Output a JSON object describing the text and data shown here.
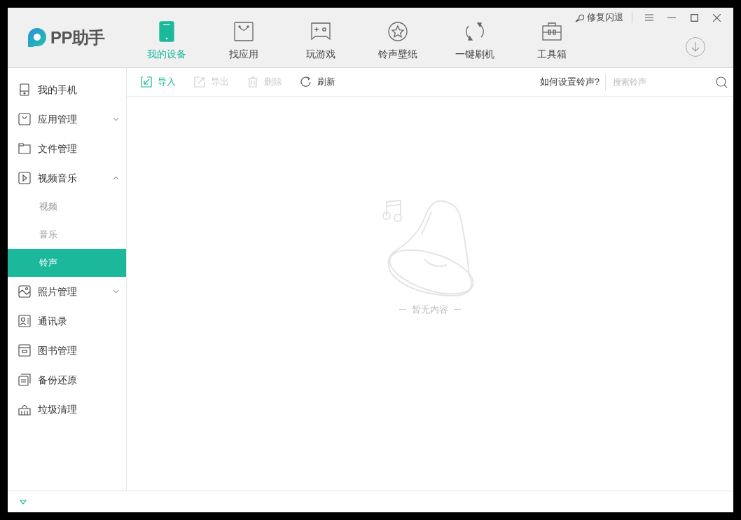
{
  "app": {
    "logo_text": "PP助手"
  },
  "nav_tabs": [
    {
      "label": "我的设备",
      "selected": true
    },
    {
      "label": "找应用",
      "selected": false
    },
    {
      "label": "玩游戏",
      "selected": false
    },
    {
      "label": "铃声壁纸",
      "selected": false
    },
    {
      "label": "一键刷机",
      "selected": false
    },
    {
      "label": "工具箱",
      "selected": false
    }
  ],
  "title_bar": {
    "repair_label": "修复闪退"
  },
  "sidebar": {
    "items": [
      {
        "label": "我的手机",
        "selected": false
      },
      {
        "label": "应用管理",
        "selected": false,
        "expanded": false
      },
      {
        "label": "文件管理",
        "selected": false
      },
      {
        "label": "视频音乐",
        "selected": false,
        "expanded": true,
        "children": [
          {
            "label": "视频",
            "selected": false
          },
          {
            "label": "音乐",
            "selected": false
          },
          {
            "label": "铃声",
            "selected": true
          }
        ]
      },
      {
        "label": "照片管理",
        "selected": false,
        "expanded": false
      },
      {
        "label": "通讯录",
        "selected": false
      },
      {
        "label": "图书管理",
        "selected": false
      },
      {
        "label": "备份还原",
        "selected": false
      },
      {
        "label": "垃圾清理",
        "selected": false
      }
    ]
  },
  "toolbar": {
    "buttons": [
      {
        "label": "导入",
        "disabled": false,
        "highlighted": true
      },
      {
        "label": "导出",
        "disabled": true,
        "highlighted": false
      },
      {
        "label": "删除",
        "disabled": true,
        "highlighted": false
      },
      {
        "label": "刷新",
        "disabled": false,
        "highlighted": false
      }
    ],
    "help_link": "如何设置铃声?",
    "search": {
      "placeholder": "搜索铃声"
    }
  },
  "empty_state": {
    "message": "暂无内容"
  }
}
